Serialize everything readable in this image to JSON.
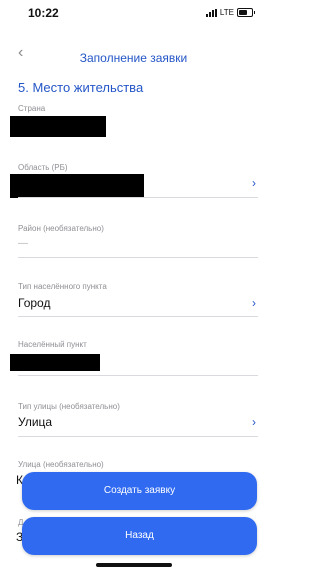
{
  "status_bar": {
    "time": "10:22",
    "network": "LTE"
  },
  "nav": {
    "back_icon": "‹",
    "title": "Заполнение заявки"
  },
  "section_title": "5. Место жительства",
  "fields": {
    "country": {
      "label": "Страна"
    },
    "region": {
      "label": "Область (РБ)",
      "chevron": "›"
    },
    "district": {
      "label": "Район (необязательно)",
      "value": "—"
    },
    "settlement_type": {
      "label": "Тип населённого пункта",
      "value": "Город",
      "chevron": "›"
    },
    "settlement": {
      "label": "Населённый пункт"
    },
    "street_type": {
      "label": "Тип улицы (необязательно)",
      "value": "Улица",
      "chevron": "›"
    },
    "street": {
      "label": "Улица (необязательно)",
      "value_prefix": "К"
    },
    "next": {
      "label_prefix": "Д",
      "value_prefix": "З"
    }
  },
  "buttons": {
    "create": "Создать заявку",
    "back": "Назад"
  },
  "colors": {
    "accent": "#2456c7",
    "button": "#2f6af0"
  }
}
